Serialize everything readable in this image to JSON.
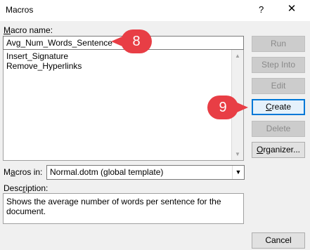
{
  "window": {
    "title": "Macros",
    "help_glyph": "?",
    "close_glyph": "✕"
  },
  "macro_name": {
    "label_first": "M",
    "label_rest": "acro name:",
    "value": "Avg_Num_Words_Sentence"
  },
  "macro_list": {
    "items": [
      "Insert_Signature",
      "Remove_Hyperlinks"
    ]
  },
  "buttons": {
    "run": "Run",
    "step_into": "Step Into",
    "edit": "Edit",
    "create_first": "C",
    "create_rest": "reate",
    "delete": "Delete",
    "organizer_first": "O",
    "organizer_rest": "rganizer...",
    "cancel": "Cancel"
  },
  "macros_in": {
    "label_first": "M",
    "label_a": "a",
    "label_rest": "cros in:",
    "value": "Normal.dotm (global template)"
  },
  "description": {
    "label_pre": "Desc",
    "label_u": "r",
    "label_rest": "iption:",
    "value": "Shows the average number of words per sentence for the document."
  },
  "callouts": {
    "first": "8",
    "second": "9",
    "color": "#e83e45"
  }
}
